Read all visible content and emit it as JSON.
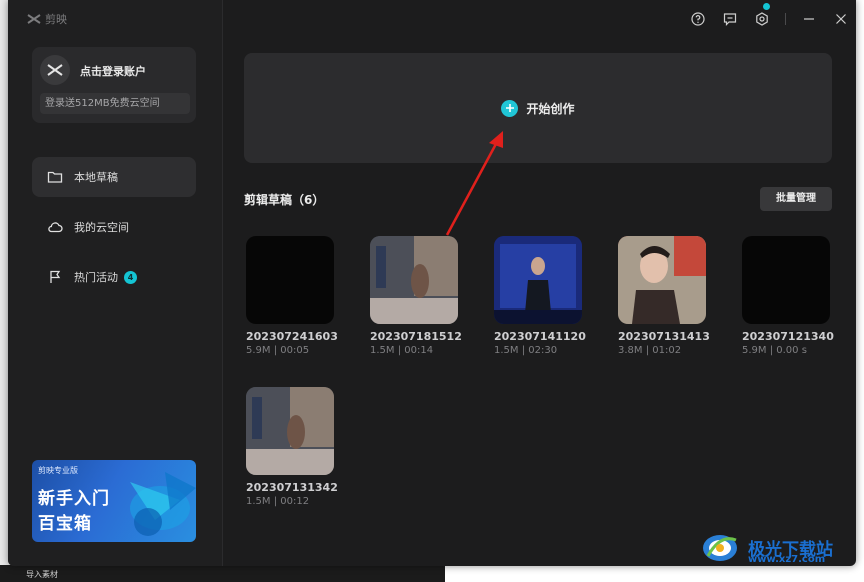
{
  "app": {
    "name": "剪映"
  },
  "account": {
    "login_label": "点击登录账户",
    "cloud_promo": "登录送512MB免费云空间"
  },
  "nav": {
    "items": [
      {
        "label": "本地草稿",
        "icon": "folder-icon",
        "active": true
      },
      {
        "label": "我的云空间",
        "icon": "cloud-icon",
        "active": false
      },
      {
        "label": "热门活动",
        "icon": "flag-icon",
        "active": false,
        "badge": "4"
      }
    ]
  },
  "banner": {
    "brand": "剪映专业版",
    "line1": "新手入门",
    "line2": "百宝箱"
  },
  "titlebar": {
    "icons": [
      "help-icon",
      "feedback-icon",
      "settings-icon",
      "minimize-icon",
      "close-icon"
    ]
  },
  "create": {
    "label": "开始创作"
  },
  "drafts": {
    "title": "剪辑草稿（6）",
    "batch_label": "批量管理",
    "items": [
      {
        "name": "202307241603",
        "size": "5.9M",
        "duration": "00:05"
      },
      {
        "name": "202307181512",
        "size": "1.5M",
        "duration": "00:14"
      },
      {
        "name": "202307141120",
        "size": "1.5M",
        "duration": "02:30"
      },
      {
        "name": "202307131413",
        "size": "3.8M",
        "duration": "01:02"
      },
      {
        "name": "202307121340",
        "size": "5.9M",
        "duration": "0.00 s"
      },
      {
        "name": "202307131342",
        "size": "1.5M",
        "duration": "00:12"
      }
    ]
  },
  "watermark": {
    "text": "极光下载站",
    "url": "www.xz7.com"
  },
  "background": {
    "import_label": "导入素材"
  },
  "colors": {
    "accent": "#14c4d3",
    "annotation": "#e0201c",
    "window_bg": "#1c1c1d"
  }
}
